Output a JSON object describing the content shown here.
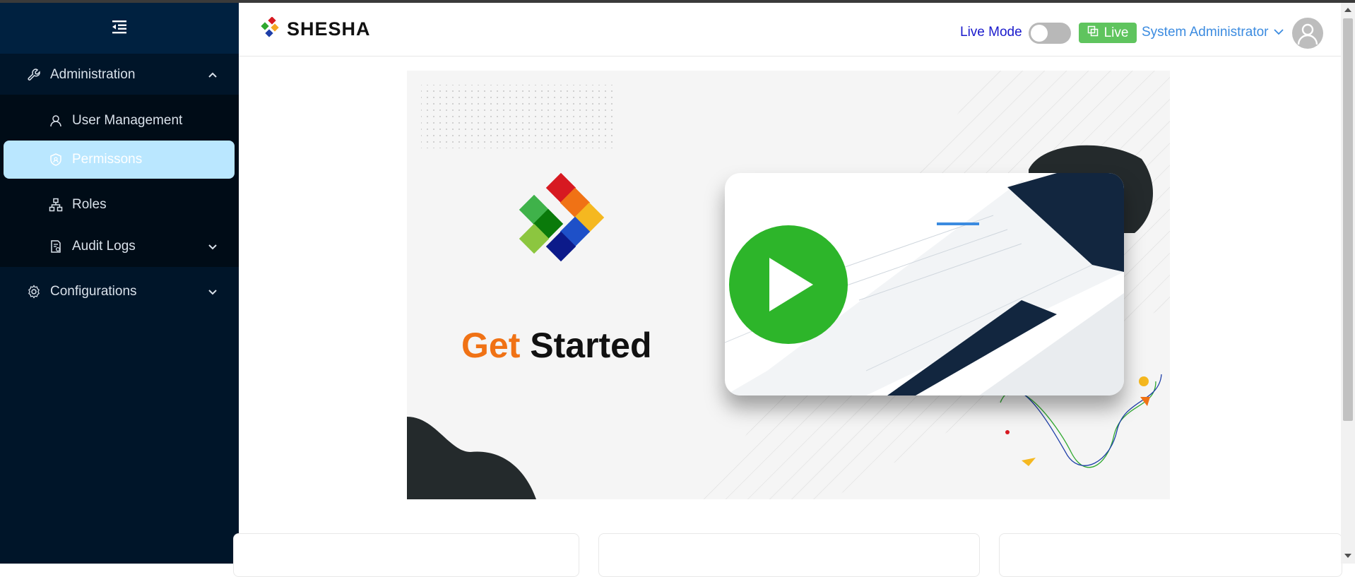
{
  "sidebar": {
    "items": [
      {
        "label": "Administration"
      },
      {
        "label": "User Management"
      },
      {
        "label": "Permissons"
      },
      {
        "label": "Roles"
      },
      {
        "label": "Audit Logs"
      },
      {
        "label": "Configurations"
      }
    ]
  },
  "header": {
    "brand": "SHESHA",
    "live_mode_label": "Live Mode",
    "live_button_label": "Live",
    "user_name": "System Administrator"
  },
  "banner": {
    "title_part1": "Get",
    "title_part2": "Started"
  },
  "colors": {
    "sidebar_bg": "#001529",
    "active_item_bg": "#bae7ff",
    "live_green": "#5fc45e",
    "accent_orange": "#f07215",
    "play_green": "#2db52a"
  }
}
